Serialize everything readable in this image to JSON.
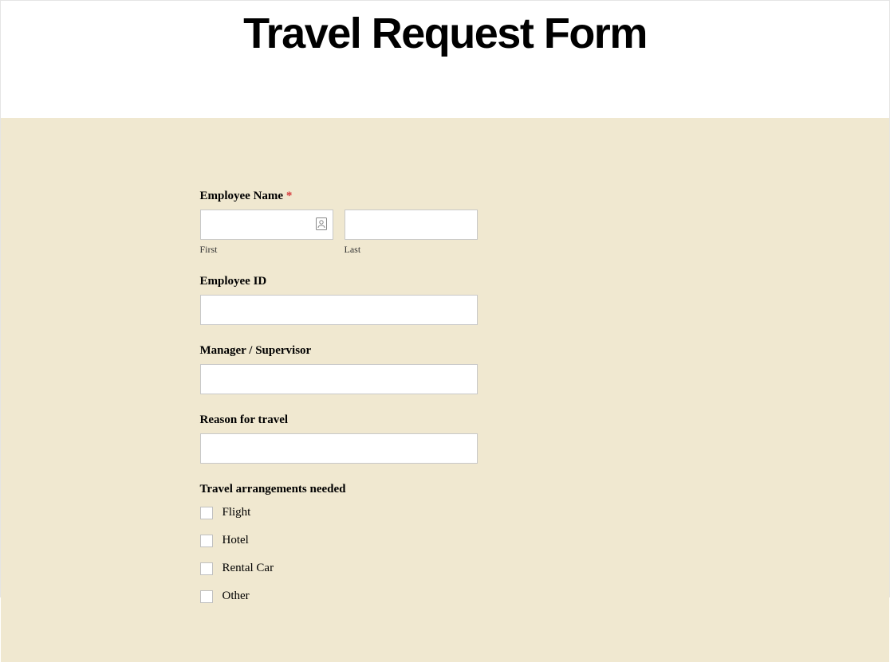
{
  "header": {
    "title": "Travel Request Form"
  },
  "form": {
    "employee_name": {
      "label": "Employee Name",
      "required_marker": "*",
      "first_sublabel": "First",
      "last_sublabel": "Last",
      "first_value": "",
      "last_value": ""
    },
    "employee_id": {
      "label": "Employee ID",
      "value": ""
    },
    "manager": {
      "label": "Manager / Supervisor",
      "value": ""
    },
    "reason": {
      "label": "Reason for travel",
      "value": ""
    },
    "arrangements": {
      "label": "Travel arrangements needed",
      "options": [
        {
          "label": "Flight"
        },
        {
          "label": "Hotel"
        },
        {
          "label": "Rental Car"
        },
        {
          "label": "Other"
        }
      ]
    }
  }
}
